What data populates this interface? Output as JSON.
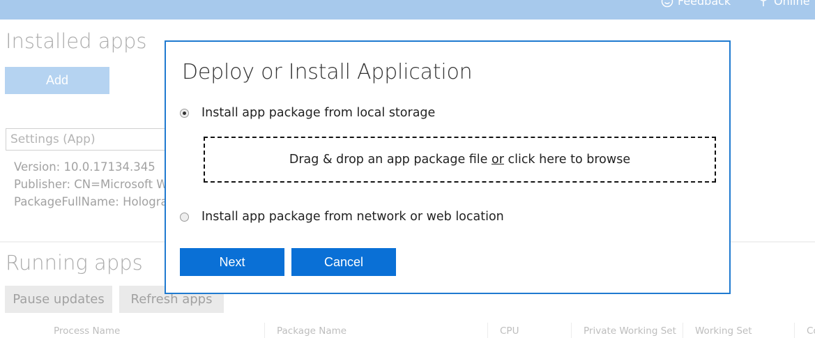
{
  "topbar": {
    "feedback_label": "Feedback",
    "online_label": "Online",
    "color": "#a7c9ec"
  },
  "installed_apps": {
    "title": "Installed apps",
    "add_label": "Add",
    "selected_app": "Settings (App)",
    "version": "Version: 10.0.17134.345",
    "publisher": "Publisher: CN=Microsoft Windows",
    "package_full_name": "PackageFullName: HolographicShell"
  },
  "running_apps": {
    "title": "Running apps",
    "pause_label": "Pause updates",
    "refresh_label": "Refresh apps",
    "columns": [
      "Process Name",
      "Package Name",
      "CPU",
      "Private Working Set",
      "Working Set",
      "Co"
    ]
  },
  "modal": {
    "title": "Deploy or Install Application",
    "option_local": "Install app package from local storage",
    "option_network": "Install app package from network or web location",
    "dropzone_prefix": "Drag & drop an app package file ",
    "dropzone_or": "or",
    "dropzone_suffix": " click here to browse",
    "next_label": "Next",
    "cancel_label": "Cancel",
    "accent": "#0a70d6"
  }
}
